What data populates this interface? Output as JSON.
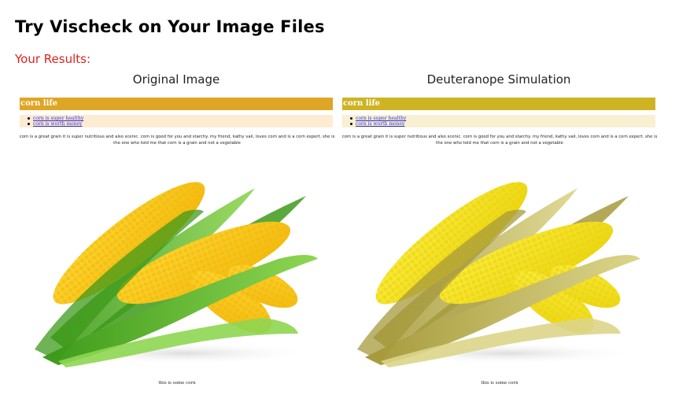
{
  "page": {
    "heading": "Try Vischeck on Your Image Files",
    "results_label": "Your Results:"
  },
  "colors": {
    "results_label": "#e0201b",
    "link": "#2b2bd6",
    "original": {
      "header_bg": "#dfa524",
      "list_bg": "#fdebd2",
      "kernel_a": "#f2b70b",
      "kernel_b": "#fcd733",
      "husk_dark": "#3e9a1b",
      "husk_light": "#8ed652"
    },
    "simulated": {
      "header_bg": "#ceb323",
      "list_bg": "#f8f0d2",
      "kernel_a": "#e9d30d",
      "kernel_b": "#fcec3f",
      "husk_dark": "#a69a3c",
      "husk_light": "#dcd58a"
    }
  },
  "images": [
    {
      "title": "Original Image",
      "header": "corn life",
      "links": [
        "corn is super healthy",
        "corn is worth money"
      ],
      "paragraph": "corn is a great grain it is super nutritious and also scenic. corn is good for you and starchy. my friend, kathy vail, loves corn and is a corn expert. she is the one who told me that corn is a grain and not a vegetable",
      "caption": "this is some corn",
      "icon": "corn-photo-icon"
    },
    {
      "title": "Deuteranope Simulation",
      "header": "corn life",
      "links": [
        "corn is super healthy",
        "corn is worth money"
      ],
      "paragraph": "corn is a great grain it is super nutritious and also scenic. corn is good for you and starchy. my friend, kathy vail, loves corn and is a corn expert. she is the one who told me that corn is a grain and not a vegetable",
      "caption": "this is some corn",
      "icon": "corn-photo-icon"
    }
  ]
}
